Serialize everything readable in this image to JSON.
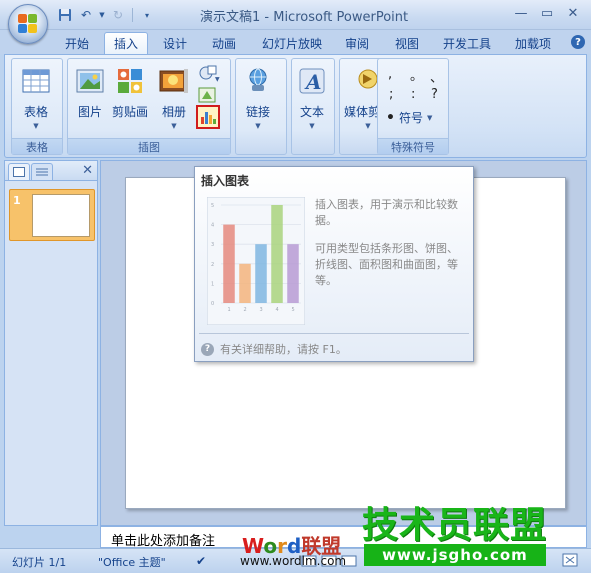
{
  "window": {
    "title": "演示文稿1 - Microsoft PowerPoint"
  },
  "tabs": [
    {
      "label": "开始",
      "active": false
    },
    {
      "label": "插入",
      "active": true
    },
    {
      "label": "设计",
      "active": false
    },
    {
      "label": "动画",
      "active": false
    },
    {
      "label": "幻灯片放映",
      "active": false
    },
    {
      "label": "审阅",
      "active": false
    },
    {
      "label": "视图",
      "active": false
    },
    {
      "label": "开发工具",
      "active": false
    },
    {
      "label": "加载项",
      "active": false
    }
  ],
  "ribbon": {
    "table": {
      "button": "表格",
      "group": "表格"
    },
    "illustrations": {
      "group": "插图",
      "picture": "图片",
      "clipart": "剪贴画",
      "album": "相册"
    },
    "links": {
      "button": "链接"
    },
    "text": {
      "button": "文本"
    },
    "media": {
      "button": "媒体剪辑"
    },
    "symbols": {
      "group": "特殊符号",
      "symbol_button": "符号",
      "chars": [
        ",",
        "。",
        "、",
        ";",
        ":",
        "?",
        "•"
      ]
    }
  },
  "tooltip": {
    "title": "插入图表",
    "desc1": "插入图表，用于演示和比较数据。",
    "desc2": "可用类型包括条形图、饼图、折线图、面积图和曲面图，等等。",
    "help": "有关详细帮助，请按 F1。"
  },
  "chart_data": {
    "type": "bar",
    "categories": [
      "1",
      "2",
      "3",
      "4",
      "5"
    ],
    "values": [
      4,
      2,
      3,
      5,
      3
    ],
    "ylim": [
      0,
      5
    ],
    "yticks": [
      "0",
      "1",
      "2",
      "3",
      "4",
      "5"
    ],
    "colors": [
      "#e58a7e",
      "#f3b47c",
      "#7fb6e0",
      "#a9d37c",
      "#b79bd3"
    ]
  },
  "slides_panel": {
    "slide_number": "1"
  },
  "notes": {
    "text": "单击此处添加备注"
  },
  "status": {
    "slide_info": "幻灯片 1/1",
    "theme": "\"Office 主题\""
  },
  "watermarks": {
    "word_w": "W",
    "word_o": "o",
    "word_r": "r",
    "word_d": "d",
    "word_cn": "联盟",
    "word_url": "www.wordlm.com",
    "jsgho_cn": "技术员联盟",
    "jsgho_url": "www.jsgho.com"
  }
}
